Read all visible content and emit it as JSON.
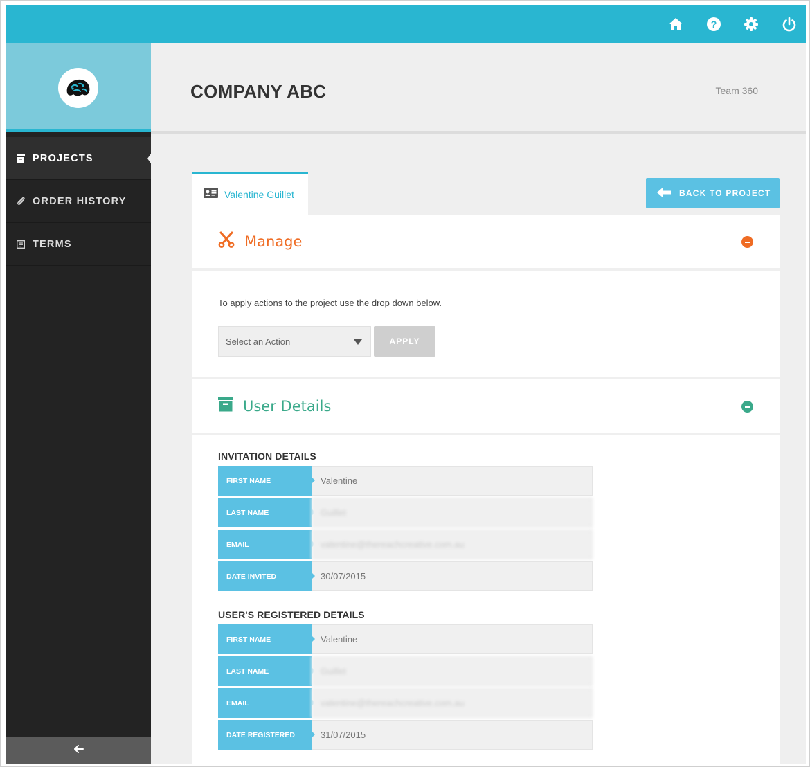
{
  "topbar": {
    "icons": [
      "home-icon",
      "help-icon",
      "gear-icon",
      "power-icon"
    ],
    "color": "#29b6d1"
  },
  "sidebar": {
    "items": [
      {
        "label": "PROJECTS",
        "icon": "archive-box-icon",
        "active": true
      },
      {
        "label": "ORDER HISTORY",
        "icon": "paperclip-icon",
        "active": false
      },
      {
        "label": "TERMS",
        "icon": "document-icon",
        "active": false
      }
    ],
    "collapse_icon": "arrow-left-icon"
  },
  "header": {
    "company": "COMPANY ABC",
    "team": "Team 360"
  },
  "tab": {
    "label": "Valentine Guillet",
    "icon": "id-card-icon"
  },
  "back_button": {
    "label": "BACK TO PROJECT",
    "icon": "arrow-left-icon"
  },
  "manage": {
    "title": "Manage",
    "icon": "scissors-icon",
    "color": "#ef6c24",
    "instructions": "To apply actions to the project use the drop down below.",
    "select_value": "Select an Action",
    "apply_label": "APPLY"
  },
  "user_details": {
    "title": "User Details",
    "icon": "archive-box-icon",
    "color": "#3aa98a",
    "invitation": {
      "title": "INVITATION DETAILS",
      "rows": [
        {
          "label": "FIRST NAME",
          "value": "Valentine"
        },
        {
          "label": "LAST NAME",
          "value": "Guillet"
        },
        {
          "label": "EMAIL",
          "value": "valentine@thereachcreative.com.au"
        },
        {
          "label": "DATE INVITED",
          "value": "30/07/2015"
        }
      ]
    },
    "registered": {
      "title": "USER'S REGISTERED DETAILS",
      "rows": [
        {
          "label": "FIRST NAME",
          "value": "Valentine"
        },
        {
          "label": "LAST NAME",
          "value": "Guillet"
        },
        {
          "label": "EMAIL",
          "value": "valentine@thereachcreative.com.au"
        },
        {
          "label": "DATE REGISTERED",
          "value": "31/07/2015"
        }
      ]
    }
  }
}
